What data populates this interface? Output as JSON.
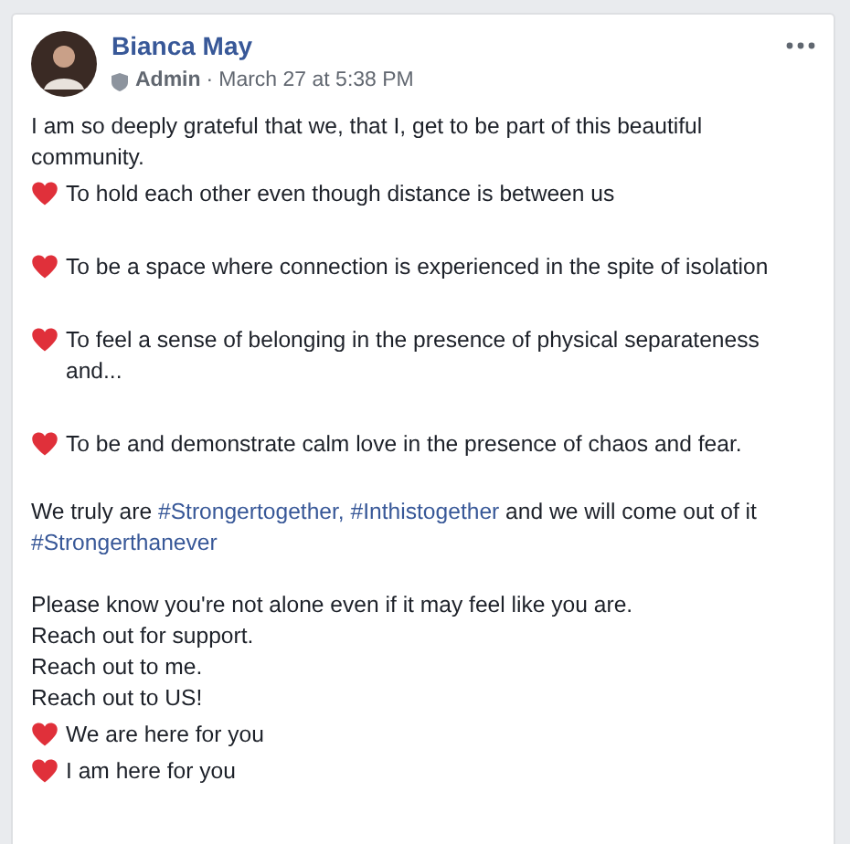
{
  "post": {
    "author": "Bianca May",
    "role": "Admin",
    "separator": "·",
    "timestamp": "March 27 at 5:38 PM",
    "body": [
      {
        "kind": "paragraph",
        "segments": [
          {
            "kind": "plain",
            "text": "I am so deeply grateful that we, that I, get to be part of this beautiful community."
          }
        ]
      },
      {
        "kind": "heart",
        "text": "To hold each other even though distance is between us"
      },
      {
        "kind": "blank"
      },
      {
        "kind": "heart",
        "text": "To be a space where connection is experienced in the spite of isolation"
      },
      {
        "kind": "blank"
      },
      {
        "kind": "heart",
        "text": "To feel a sense of belonging in the presence of physical separateness and..."
      },
      {
        "kind": "blank"
      },
      {
        "kind": "heart",
        "text": "To be and demonstrate calm love in the presence of chaos and fear."
      },
      {
        "kind": "blank"
      },
      {
        "kind": "paragraph",
        "segments": [
          {
            "kind": "plain",
            "text": "We truly are "
          },
          {
            "kind": "hashtag",
            "text": "#Strongertogether,"
          },
          {
            "kind": "hashtag",
            "text": "#Inthistogether"
          },
          {
            "kind": "plain",
            "text": " and we will come out of it "
          },
          {
            "kind": "hashtag",
            "text": "#Strongerthanever"
          }
        ]
      },
      {
        "kind": "blank"
      },
      {
        "kind": "paragraph",
        "segments": [
          {
            "kind": "plain",
            "text": "Please know you're not alone even if it may feel like you are."
          }
        ]
      },
      {
        "kind": "paragraph",
        "segments": [
          {
            "kind": "plain",
            "text": "Reach out for support."
          }
        ]
      },
      {
        "kind": "paragraph",
        "segments": [
          {
            "kind": "plain",
            "text": "Reach out to me."
          }
        ]
      },
      {
        "kind": "paragraph",
        "segments": [
          {
            "kind": "plain",
            "text": "Reach out to US!"
          }
        ]
      },
      {
        "kind": "heart",
        "text": "We are here for you"
      },
      {
        "kind": "heart",
        "text": "I am here for you"
      }
    ]
  }
}
